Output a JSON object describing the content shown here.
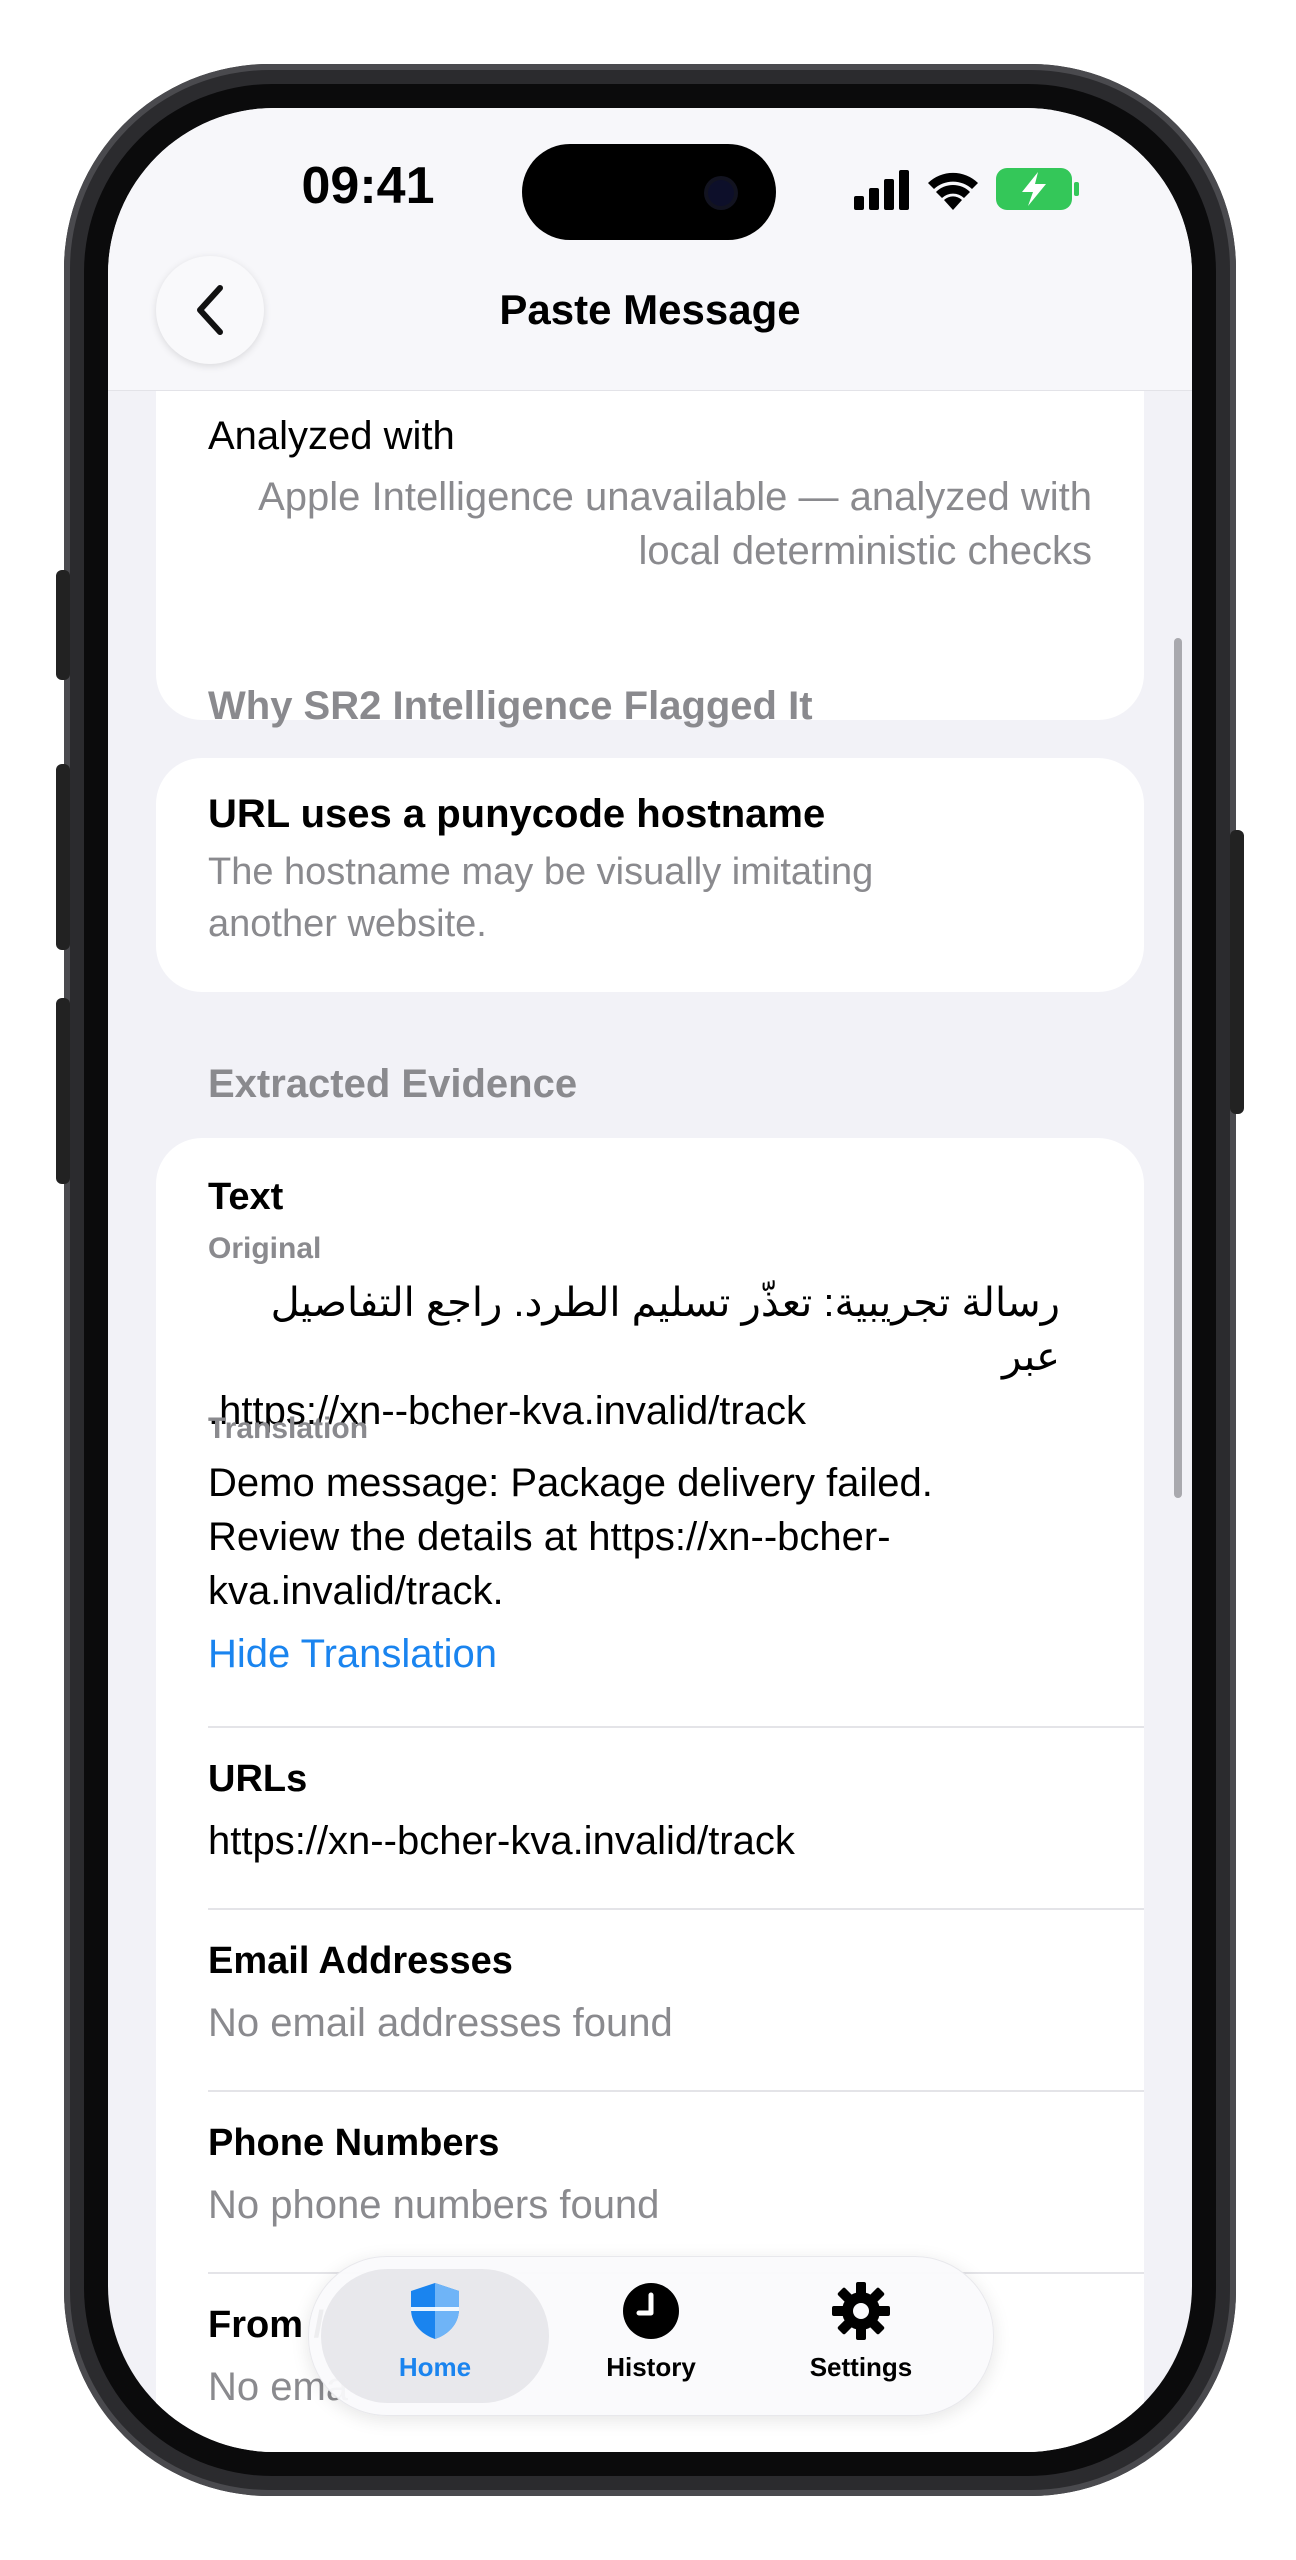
{
  "status_bar": {
    "time": "09:41"
  },
  "nav": {
    "title": "Paste Message",
    "back_icon": "chevron-left-icon"
  },
  "analyzed": {
    "label": "Analyzed with",
    "value_line1": "Apple Intelligence unavailable — analyzed with",
    "value_line2": "local deterministic checks"
  },
  "flagged": {
    "header": "Why SR2 Intelligence Flagged It",
    "title": "URL uses a punycode hostname",
    "desc_line1": "The hostname may be visually imitating",
    "desc_line2": "another website."
  },
  "evidence": {
    "header": "Extracted Evidence",
    "text": {
      "title": "Text",
      "original_label": "Original",
      "original_line1": "رسالة تجريبية: تعذّر تسليم الطرد. راجع التفاصيل عبر",
      "original_line2": ".https://xn--bcher-kva.invalid/track",
      "translation_label": "Translation",
      "translation_line1": "Demo message: Package delivery failed.",
      "translation_line2": "Review the details at https://xn--bcher-",
      "translation_line3": "kva.invalid/track.",
      "toggle": "Hide Translation"
    },
    "urls": {
      "title": "URLs",
      "value": "https://xn--bcher-kva.invalid/track"
    },
    "emails": {
      "title": "Email Addresses",
      "value": "No email addresses found"
    },
    "phones": {
      "title": "Phone Numbers",
      "value": "No phone numbers found"
    },
    "from": {
      "title": "From /",
      "value": "No ema"
    }
  },
  "tabbar": {
    "tabs": [
      {
        "label": "Home",
        "icon": "shield-icon",
        "active": true
      },
      {
        "label": "History",
        "icon": "clock-icon",
        "active": false
      },
      {
        "label": "Settings",
        "icon": "gear-icon",
        "active": false
      }
    ]
  },
  "colors": {
    "accent": "#1a84ef",
    "battery": "#34c759",
    "secondary": "#8a8a8e"
  }
}
